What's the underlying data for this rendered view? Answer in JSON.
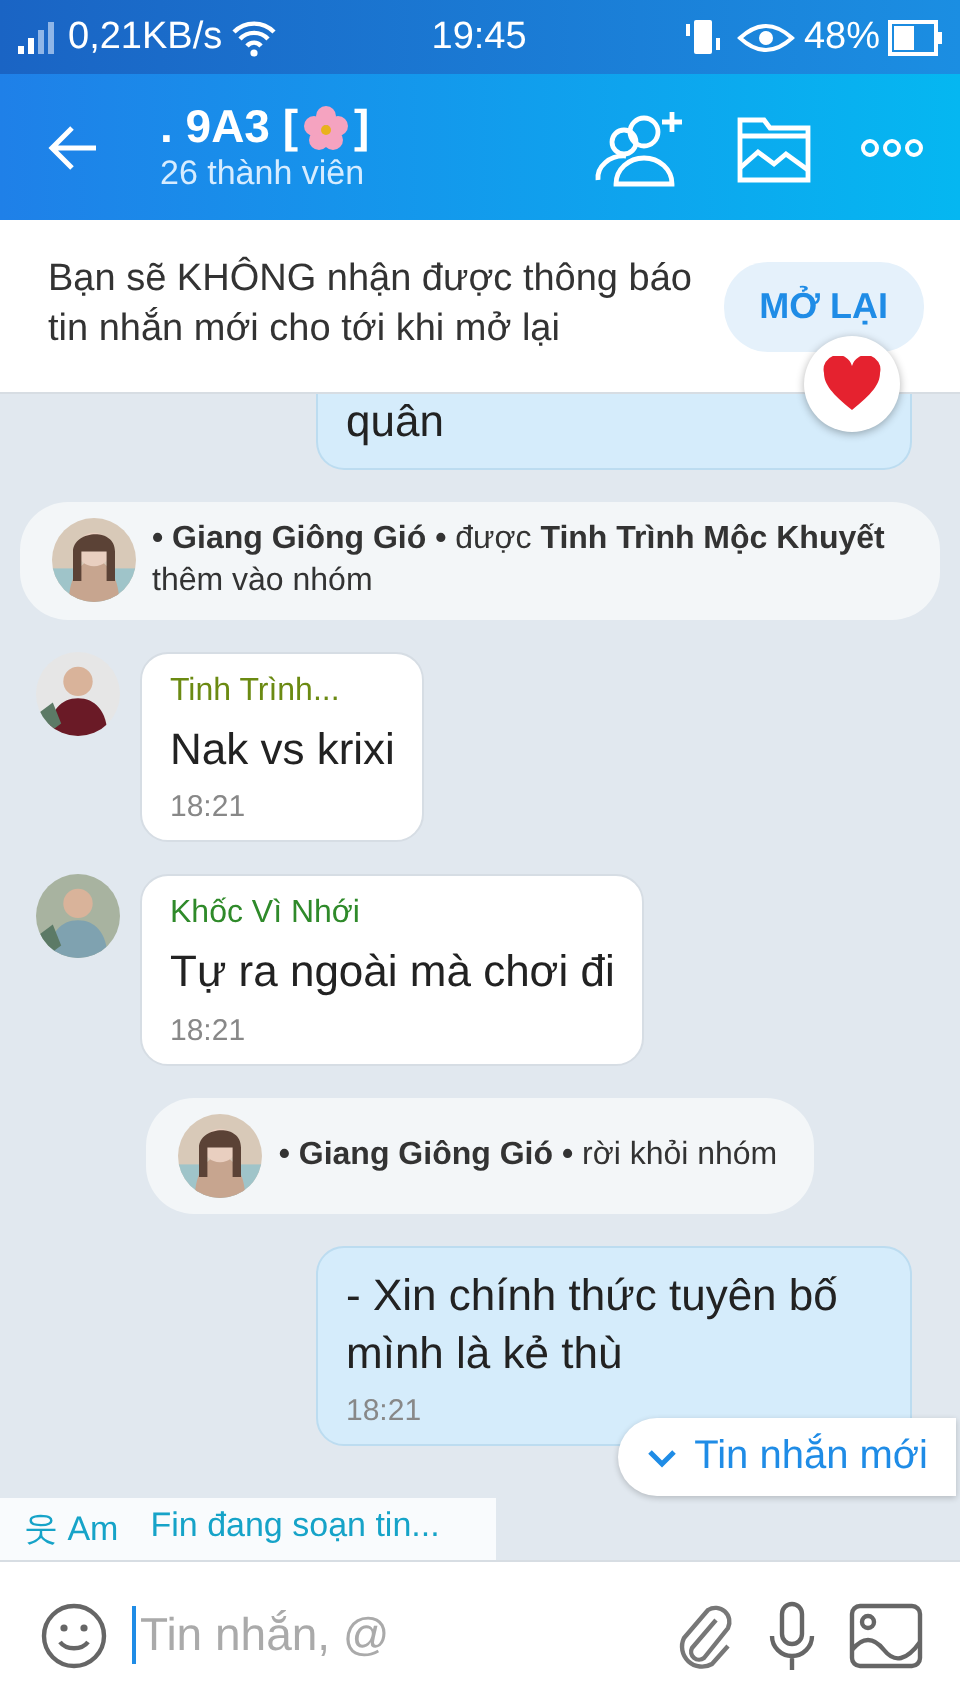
{
  "status_bar": {
    "speed": "0,21KB/s",
    "time": "19:45",
    "battery": "48%"
  },
  "header": {
    "title": ". 9A3 [",
    "title_end": "]",
    "subtitle": "26 thành viên"
  },
  "notice": {
    "text": "Bạn sẽ KHÔNG nhận được thông báo tin nhắn mới cho tới khi mở lại",
    "button": "MỞ LẠI"
  },
  "messages": [
    {
      "kind": "outgoing",
      "text": "quân"
    },
    {
      "kind": "system",
      "text": "**• Giang Giông Gió •** được **Tinh Trình Mộc Khuyết** thêm vào nhóm"
    },
    {
      "kind": "incoming",
      "sender": "Tinh Trình...",
      "color": "#6b8a12",
      "text": "Nak vs krixi",
      "time": "18:21"
    },
    {
      "kind": "incoming",
      "sender": "Khốc Vì Nhới",
      "color": "#2f8a2a",
      "text": "Tự ra ngoài mà chơi đi",
      "time": "18:21"
    },
    {
      "kind": "system",
      "text": "**• Giang Giông Gió •** rời khỏi nhóm"
    },
    {
      "kind": "outgoing",
      "text": "- Xin chính thức tuyên bố mình là kẻ thù",
      "time": "18:21"
    }
  ],
  "new_messages_button": "Tin nhắn mới",
  "typing": {
    "icon": "웃",
    "name": "Am",
    "text": "Fin đang soạn tin..."
  },
  "composer": {
    "placeholder": "Tin nhắn, @"
  }
}
